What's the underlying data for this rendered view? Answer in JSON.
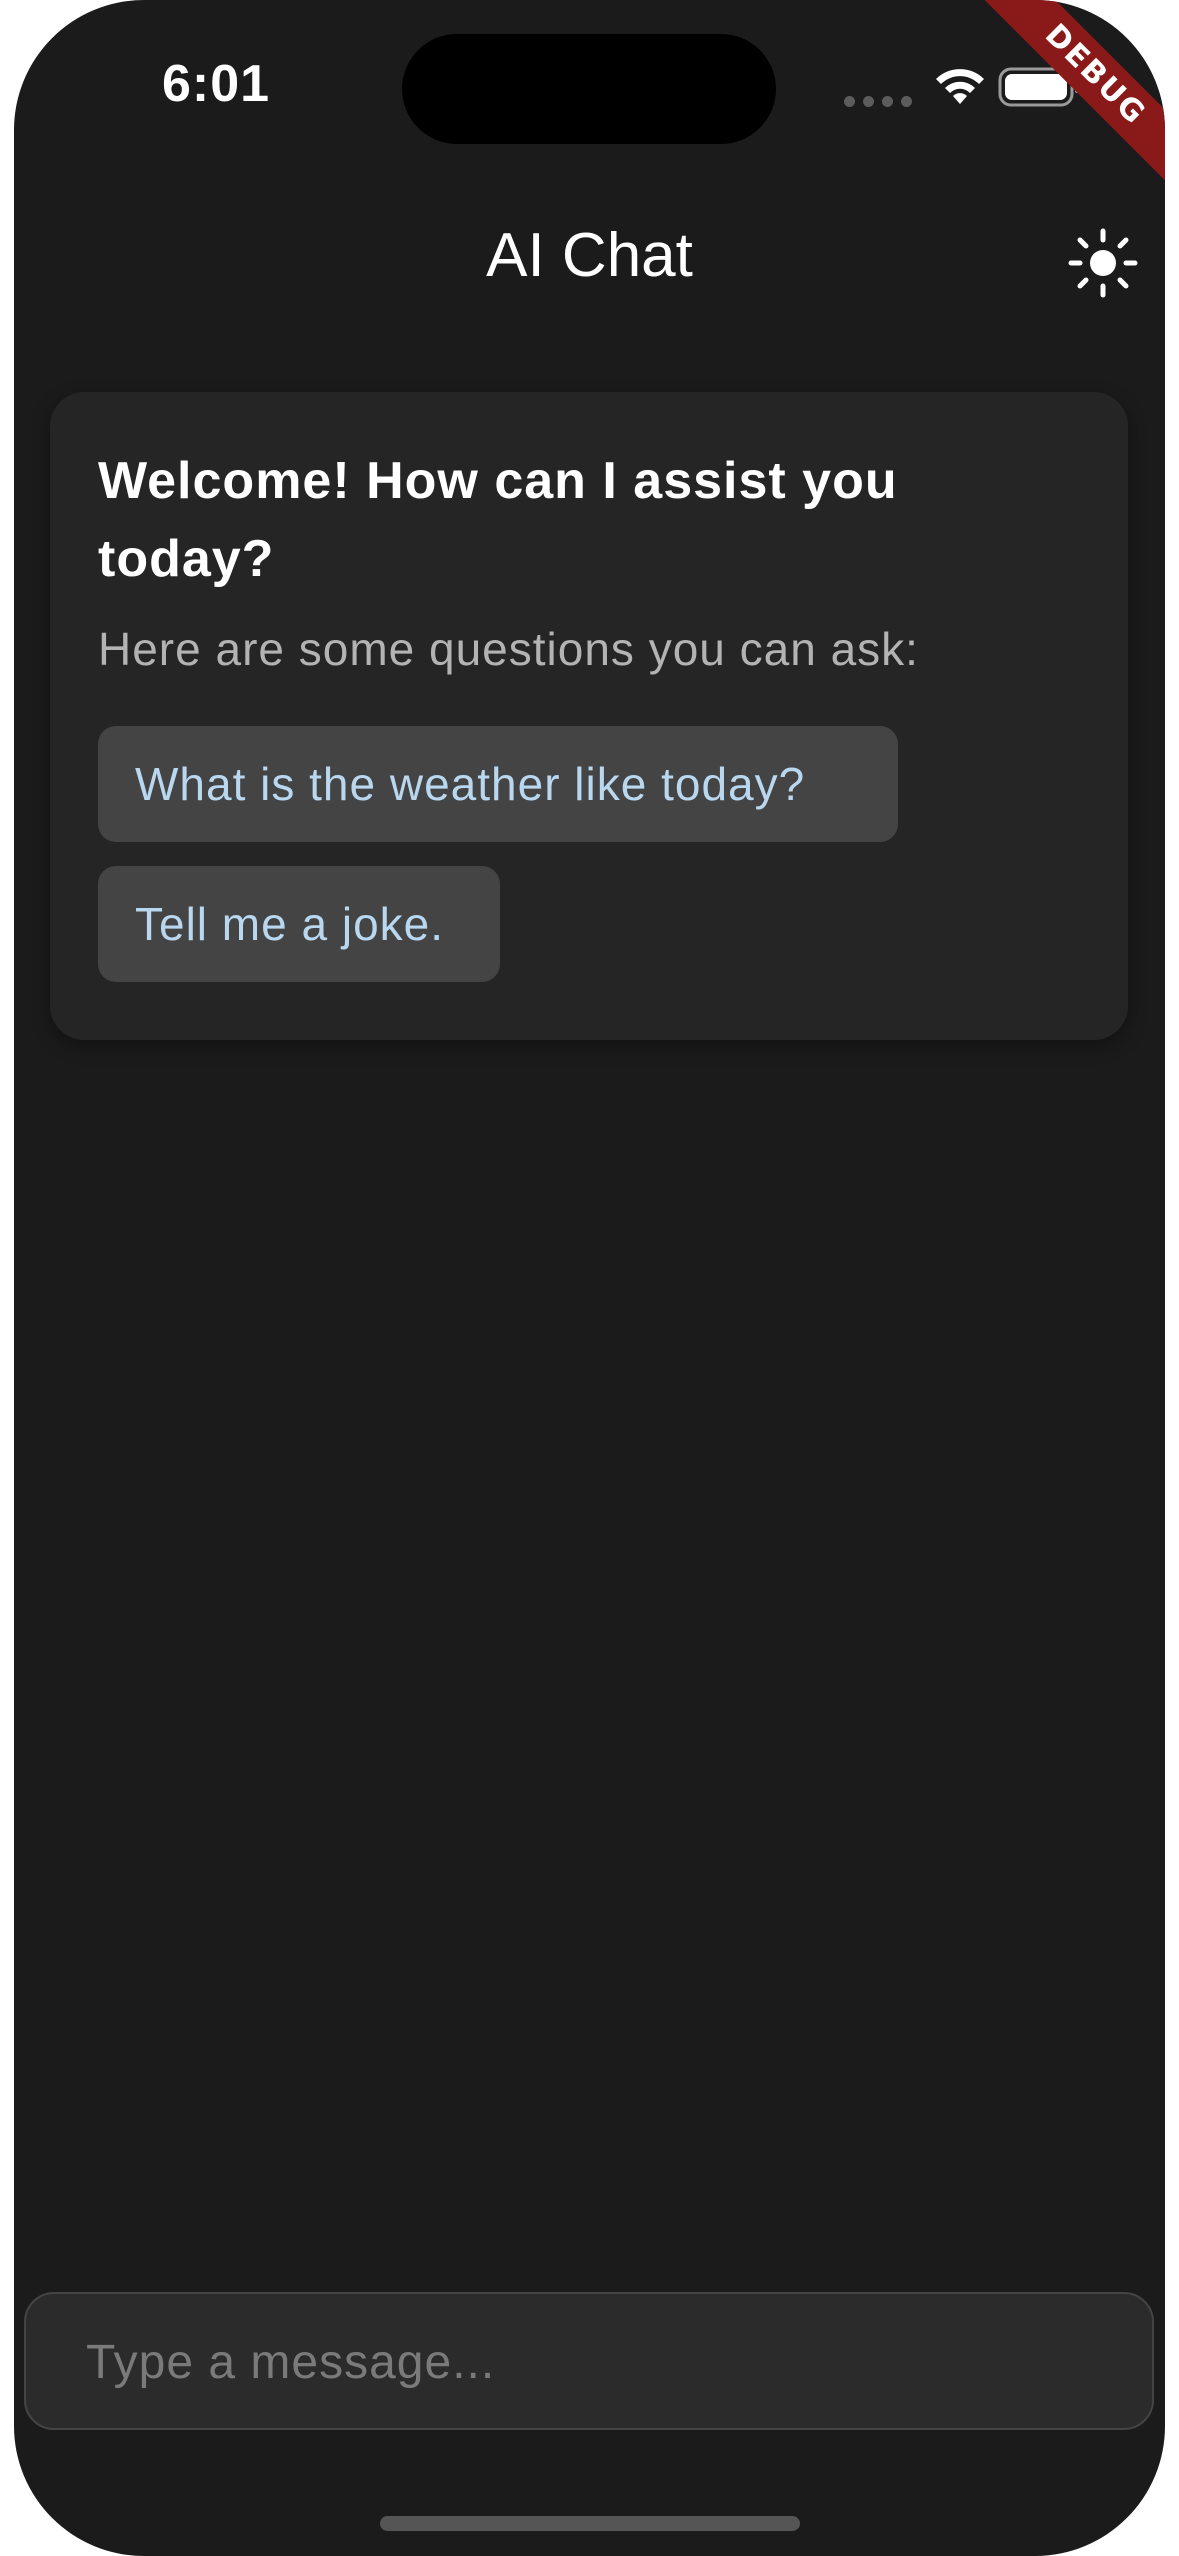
{
  "status_bar": {
    "time": "6:01",
    "icons": [
      "signal-dots-icon",
      "wifi-icon",
      "battery-icon"
    ]
  },
  "debug_banner": "DEBUG",
  "app_bar": {
    "title": "AI Chat",
    "theme_toggle_icon": "sun-icon"
  },
  "welcome": {
    "title": "Welcome! How can I assist you today?",
    "subtitle": "Here are some questions you can ask:",
    "suggestions": [
      {
        "label": "What is the weather like today?"
      },
      {
        "label": "Tell me a joke."
      }
    ]
  },
  "composer": {
    "placeholder": "Type a message...",
    "value": ""
  },
  "colors": {
    "background": "#1b1b1b",
    "card": "#252525",
    "chip": "#444444",
    "chip_text": "#b9d7ef",
    "debug": "#8a1a1a"
  }
}
